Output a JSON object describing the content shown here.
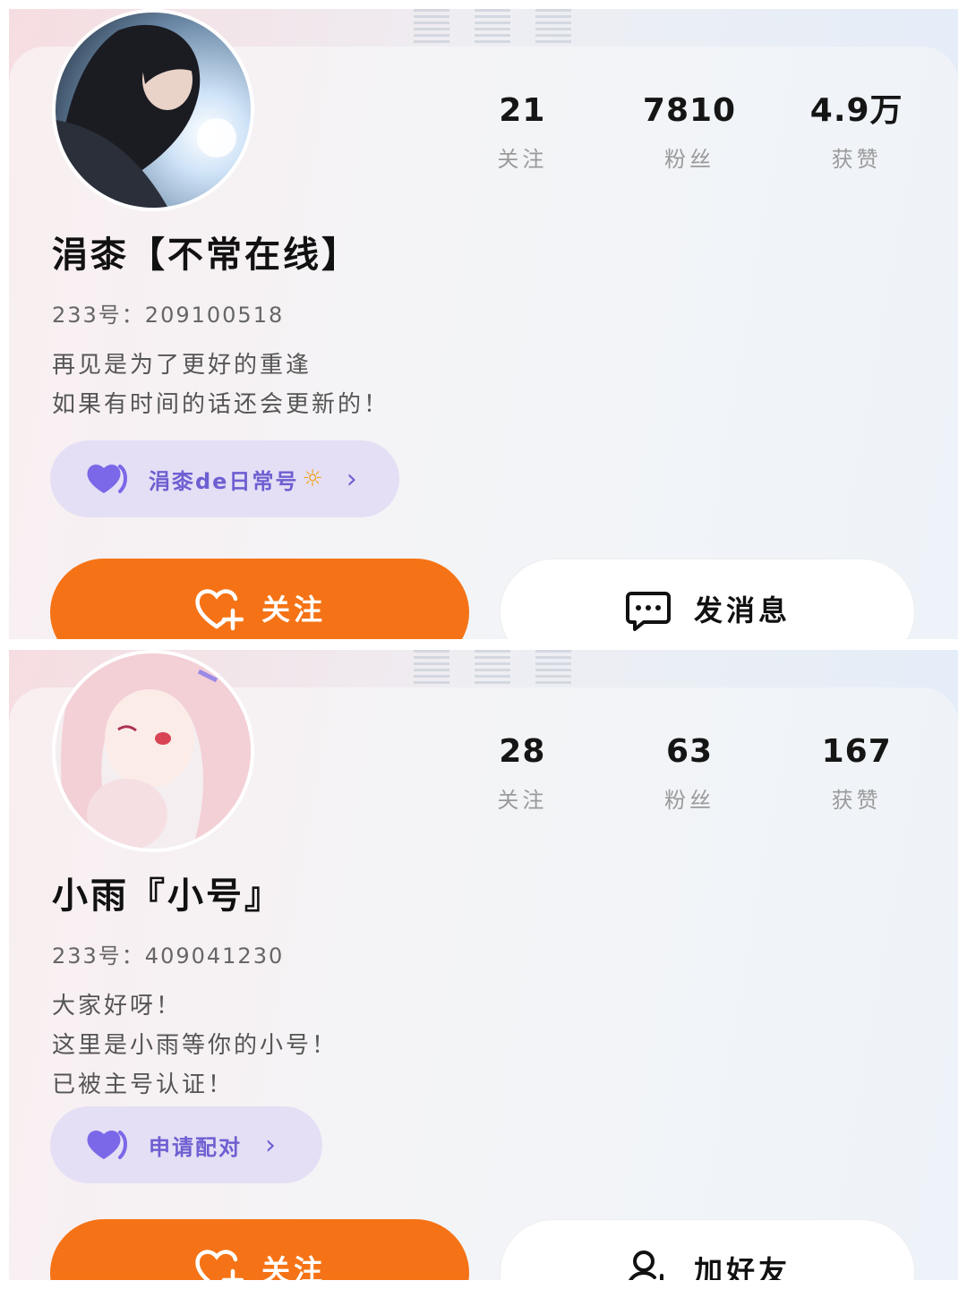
{
  "profiles": [
    {
      "stats": [
        {
          "value": "21",
          "label": "关注"
        },
        {
          "value": "7810",
          "label": "粉丝"
        },
        {
          "value": "4.9万",
          "label": "获赞"
        }
      ],
      "nickname": "涓桼【不常在线】",
      "uid": "233号：209100518",
      "bio": [
        "再见是为了更好的重逢",
        "如果有时间的话还会更新的！"
      ],
      "link": {
        "label": "涓桼de日常号",
        "icon": "heart-icon",
        "trail_icon": "sun-icon"
      },
      "primary_button": {
        "label": "关注",
        "icon": "heart-plus-icon"
      },
      "secondary_button": {
        "label": "发消息",
        "icon": "chat-icon"
      }
    },
    {
      "stats": [
        {
          "value": "28",
          "label": "关注"
        },
        {
          "value": "63",
          "label": "粉丝"
        },
        {
          "value": "167",
          "label": "获赞"
        }
      ],
      "nickname": "小雨『小号』",
      "uid": "233号：409041230",
      "bio": [
        "大家好呀！",
        "这里是小雨等你的小号！",
        "已被主号认证！"
      ],
      "link": {
        "label": "申请配对",
        "icon": "heart-icon"
      },
      "primary_button": {
        "label": "关注",
        "icon": "heart-plus-icon"
      },
      "secondary_button": {
        "label": "加好友",
        "icon": "add-friend-icon"
      }
    }
  ],
  "colors": {
    "accent": "#f57316",
    "pill_bg": "#e4dff5",
    "pill_text": "#6e5fd1"
  }
}
